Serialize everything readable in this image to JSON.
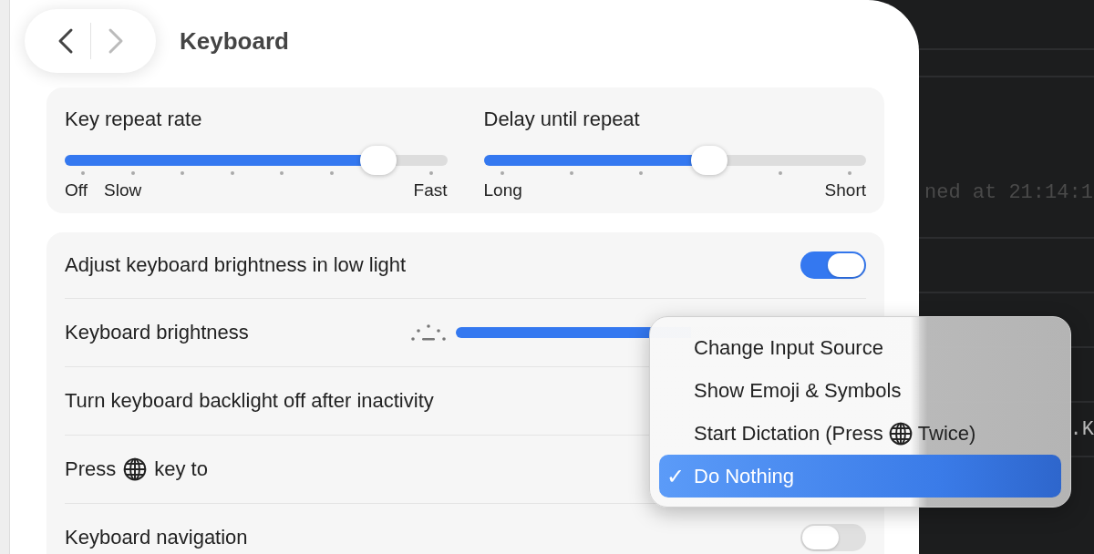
{
  "window": {
    "title": "Keyboard"
  },
  "nav": {
    "back_enabled": true,
    "forward_enabled": false
  },
  "repeat_sliders": [
    {
      "label": "Key repeat rate",
      "level": 0.82,
      "min_labels": [
        "Off",
        "Slow"
      ],
      "max_label": "Fast"
    },
    {
      "label": "Delay until repeat",
      "level": 0.59,
      "min_labels": [
        "Long"
      ],
      "max_label": "Short"
    }
  ],
  "rows": [
    {
      "kind": "toggle",
      "label": "Adjust keyboard brightness in low light",
      "on": true
    },
    {
      "kind": "brightness",
      "label": "Keyboard brightness"
    },
    {
      "kind": "plain",
      "label": "Turn keyboard backlight off after inactivity"
    },
    {
      "kind": "globe",
      "label_parts": [
        "Press",
        "key to"
      ]
    },
    {
      "kind": "toggle",
      "label": "Keyboard navigation",
      "on": false
    }
  ],
  "menu": {
    "items": [
      {
        "kind": "text",
        "label": "Change Input Source",
        "selected": false
      },
      {
        "kind": "text",
        "label": "Show Emoji & Symbols",
        "selected": false
      },
      {
        "kind": "globe",
        "label_parts": [
          "Start Dictation (Press",
          "Twice)"
        ],
        "selected": false
      },
      {
        "kind": "text",
        "label": "Do Nothing",
        "selected": true
      }
    ],
    "check_mark": "✓"
  },
  "background_text": [
    "ned at 21:14:1",
    ".K"
  ]
}
